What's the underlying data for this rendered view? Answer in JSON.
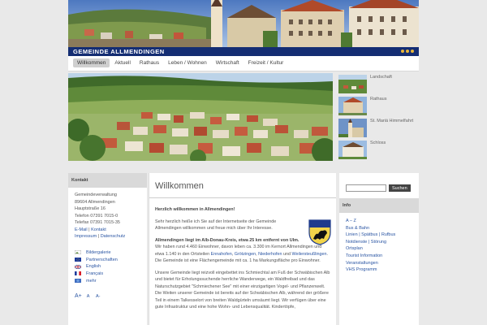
{
  "header": {
    "title": "GEMEINDE ALLMENDINGEN"
  },
  "nav": {
    "items": [
      "Willkommen",
      "Aktuell",
      "Rathaus",
      "Leben / Wohnen",
      "Wirtschaft",
      "Freizeit / Kultur"
    ]
  },
  "thumbs": [
    {
      "label": "Landschaft"
    },
    {
      "label": "Rathaus"
    },
    {
      "label": "St. Mariä Himmelfahrt"
    },
    {
      "label": "Schloss"
    }
  ],
  "contact": {
    "title": "Kontakt",
    "lines": [
      "Gemeindeverwaltung",
      "89604 Allmendingen",
      "Hauptstraße 16",
      "Telefon 07391 7015-0",
      "Telefax 07391 7015-35"
    ],
    "email_label": "E-Mail",
    "sep": "|",
    "kontakt_label": "Kontakt",
    "impressum_label": "Impressum",
    "datenschutz_label": "Datenschutz"
  },
  "flags": [
    {
      "label": "Bildergalerie",
      "icon": "gallery-icon"
    },
    {
      "label": "Partnerschaften",
      "icon": "eu-flag-icon"
    },
    {
      "label": "English",
      "icon": "uk-flag-icon"
    },
    {
      "label": "Français",
      "icon": "fr-flag-icon"
    },
    {
      "label": "mehr",
      "icon": "globe-icon"
    }
  ],
  "font_sizes": {
    "large": "A+",
    "normal": "A ",
    "small": "A-"
  },
  "main": {
    "heading": "Willkommen",
    "greeting": "Herzlich willkommen in Allmendingen!",
    "p1": "Sehr herzlich heiße ich Sie auf der Internetseite der Gemeinde Allmendingen willkommen und freue mich über Ihr Interesse.",
    "p2_bold": "Allmendingen liegt im Alb-Donau-Kreis, etwa 25 km entfernt von Ulm.",
    "p2_a": "Wir haben rund 4.460 Einwohner, davon leben ca. 3.300 im Kernort Allmendingen und etwa 1.140 in den Ortsteilen",
    "p2_l1": "Ennahofen",
    "p2_c1": ",",
    "p2_l2": "Grötzingen",
    "p2_c2": ",",
    "p2_l3": "Niederhofen",
    "p2_and": "und",
    "p2_l4": "Weilersteußlingen",
    "p2_b": ". Die Gemeinde ist eine Flächengemeinde mit ca. 1 ha Markungsfläche pro Einwohner.",
    "p3": "Unsere Gemeinde liegt reizvoll eingebettet ins Schmiechtal am Fuß der Schwäbischen Alb und bietet für Erholungssuchende herrliche Wanderwege, ein Waldfreibad und das Naturschutzgebiet \"Schmiechener See\" mit einer einzigartigen Vogel- und Pflanzenwelt. Die Weiten unserer Gemeinde ist bereits auf der Schwäbischen Alb, während der größere Teil in einem Talkesselort von breiten Waldgürteln umsäumt liegt. Wir verfügen über eine gute Infrastruktur und eine hohe Wohn- und Lebensqualität. Kindertöpfe,"
  },
  "right": {
    "search_button": "Suchen",
    "info_title": "Info",
    "items": [
      "A – Z",
      "Bus & Bahn",
      "Linien | Spätbus | Rufbus",
      "Notdienste | Störung",
      "Ortsplan",
      "Tourist Information",
      "Veranstaltungen",
      "VHS Programm"
    ]
  },
  "colors": {
    "navy": "#142d73",
    "link": "#2a55a3",
    "accent": "#e8b53a"
  }
}
